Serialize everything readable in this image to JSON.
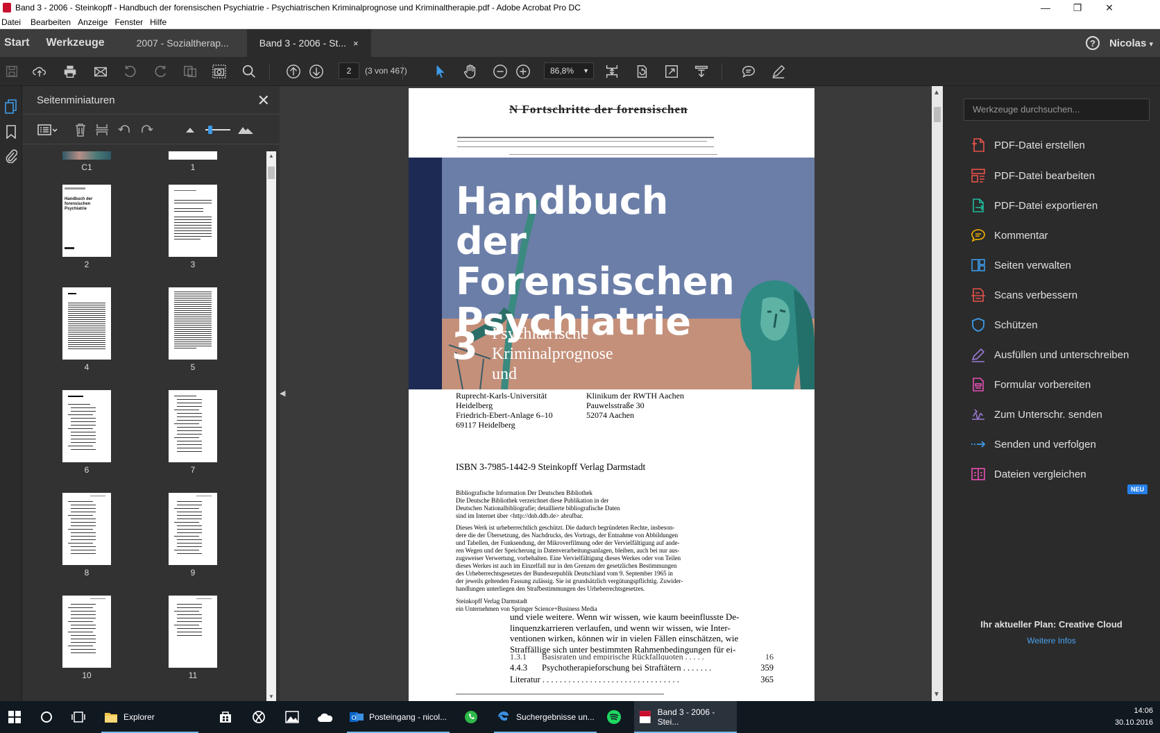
{
  "window": {
    "title": "Band 3 - 2006 - Steinkopff - Handbuch der forensischen Psychiatrie - Psychiatrischen Kriminalprognose und Kriminaltherapie.pdf - Adobe Acrobat Pro DC",
    "minimize": "—",
    "restore": "❐",
    "close": "✕"
  },
  "menu": [
    "Datei",
    "Bearbeiten",
    "Anzeige",
    "Fenster",
    "Hilfe"
  ],
  "tabs": {
    "start": "Start",
    "werkzeuge": "Werkzeuge",
    "doc1": "2007 - Sozialtherap...",
    "doc2": "Band 3 - 2006 - St...",
    "doc2_close": "×",
    "help": "?",
    "user": "Nicolas",
    "user_arrow": "▾"
  },
  "toolbar": {
    "page_current": "2",
    "page_of": "(3 von 467)",
    "zoom": "86,8%",
    "zoom_arrow": "▼"
  },
  "thumbnails": {
    "title": "Seitenminiaturen",
    "close": "✕",
    "pages": [
      "C1",
      "1",
      "2",
      "3",
      "4",
      "5",
      "6",
      "7",
      "8",
      "9",
      "10",
      "11"
    ],
    "thumb2_title": "Handbuch der forensischen Psychiatrie"
  },
  "document": {
    "header_scribble": "N  Fortschritte der forensischen",
    "cover_title_1": "Handbuch",
    "cover_title_2": "der Forensischen",
    "cover_title_3": "Psychiatrie",
    "cover_number": "3",
    "cover_sub_1": "Psychiatrische",
    "cover_sub_2": "Kriminalprognose",
    "cover_sub_3": "und",
    "addr_left_1": "Ruprecht-Karls-Universität",
    "addr_left_2": "Heidelberg",
    "addr_left_3": "Friedrich-Ebert-Anlage 6–10",
    "addr_left_4": "69117 Heidelberg",
    "addr_right_1": "Klinikum der RWTH Aachen",
    "addr_right_2": "Pauwelsstraße 30",
    "addr_right_3": "52074 Aachen",
    "isbn": "ISBN 3-7985-1442-9 Steinkopff Verlag Darmstadt",
    "biblio_1": "Bibliografische Information Der Deutschen Bibliothek",
    "biblio_2": "Die Deutsche Bibliothek verzeichnet diese Publikation in der",
    "biblio_3": "Deutschen Nationalbibliografie; detaillierte bibliografische Daten",
    "biblio_4": "sind im Internet über <http://dnb.ddb.de> abrufbar.",
    "copy_1": "Dieses Werk ist urheberrechtlich geschützt. Die dadurch begründeten Rechte, insbeson-",
    "copy_2": "dere die der Übersetzung, des Nachdrucks, des Vortrags, der Entnahme von Abbildungen",
    "copy_3": "und Tabellen, der Funksendung, der Mikroverfilmung oder der Vervielfältigung auf ande-",
    "copy_4": "ren Wegen und der Speicherung in Datenverarbeitungsanlagen, bleiben, auch bei nur aus-",
    "copy_5": "zugsweiser Verwertung, vorbehalten. Eine Vervielfältigung dieses Werkes oder von Teilen",
    "copy_6": "dieses Werkes ist auch im Einzelfall nur in den Grenzen der gesetzlichen Bestimmungen",
    "copy_7": "des Urheberrechtsgesetzes der Bundesrepublik Deutschland vom 9. September 1965 in",
    "copy_8": "der jeweils geltenden Fassung zulässig. Sie ist grundsätzlich vergütungspflichtig. Zuwider-",
    "copy_9": "handlungen unterliegen den Strafbestimmungen des Urheberrechtsgesetzes.",
    "pub_1": "Steinkopff Verlag Darmstadt",
    "pub_2": "ein Unternehmen von Springer Science+Business Media",
    "body_1": "und viele weitere. Wenn wir wissen, wie kaum beeinflusste De-",
    "body_2": "linquenzkarrieren verlaufen, und wenn wir wissen, wie Inter-",
    "body_3": "ventionen wirken, können wir in vielen Fällen einschätzen, wie",
    "body_4": "Straffällige sich unter bestimmten Rahmenbedingungen für ei-",
    "toc_1_num": "1.3.1",
    "toc_1_title": "Basisraten und empirische Rückfallquoten . . . . .",
    "toc_1_page": "16",
    "toc_2_num": "4.4.3",
    "toc_2_title": "Psychotherapieforschung bei Straftätern . . . . . . .",
    "toc_2_page": "359",
    "toc_3_title": "Literatur . . . . . . . . . . . . . . . . . . . . . . . . . . . . . . . .",
    "toc_3_page": "365"
  },
  "tools": {
    "search_placeholder": "Werkzeuge durchsuchen...",
    "items": [
      {
        "label": "PDF-Datei erstellen",
        "color": "#e8524a"
      },
      {
        "label": "PDF-Datei bearbeiten",
        "color": "#e8524a"
      },
      {
        "label": "PDF-Datei exportieren",
        "color": "#1fbc9c"
      },
      {
        "label": "Kommentar",
        "color": "#f6b400"
      },
      {
        "label": "Seiten verwalten",
        "color": "#3d9be9"
      },
      {
        "label": "Scans verbessern",
        "color": "#e8524a"
      },
      {
        "label": "Schützen",
        "color": "#3d9be9"
      },
      {
        "label": "Ausfüllen und unterschreiben",
        "color": "#9d7bd8"
      },
      {
        "label": "Formular vorbereiten",
        "color": "#e84fb5"
      },
      {
        "label": "Zum Unterschr. senden",
        "color": "#9d7bd8"
      },
      {
        "label": "Senden und verfolgen",
        "color": "#3d9be9"
      },
      {
        "label": "Dateien vergleichen",
        "color": "#e84fb5"
      }
    ],
    "new_badge": "NEU",
    "plan": "Ihr aktueller Plan: Creative Cloud",
    "more_info": "Weitere Infos"
  },
  "taskbar": {
    "explorer": "Explorer",
    "outlook": "Posteingang - nicol...",
    "edge": "Suchergebnisse un...",
    "acrobat": "Band 3 - 2006 - Stei...",
    "time": "14:06",
    "date": "30.10.2016"
  }
}
